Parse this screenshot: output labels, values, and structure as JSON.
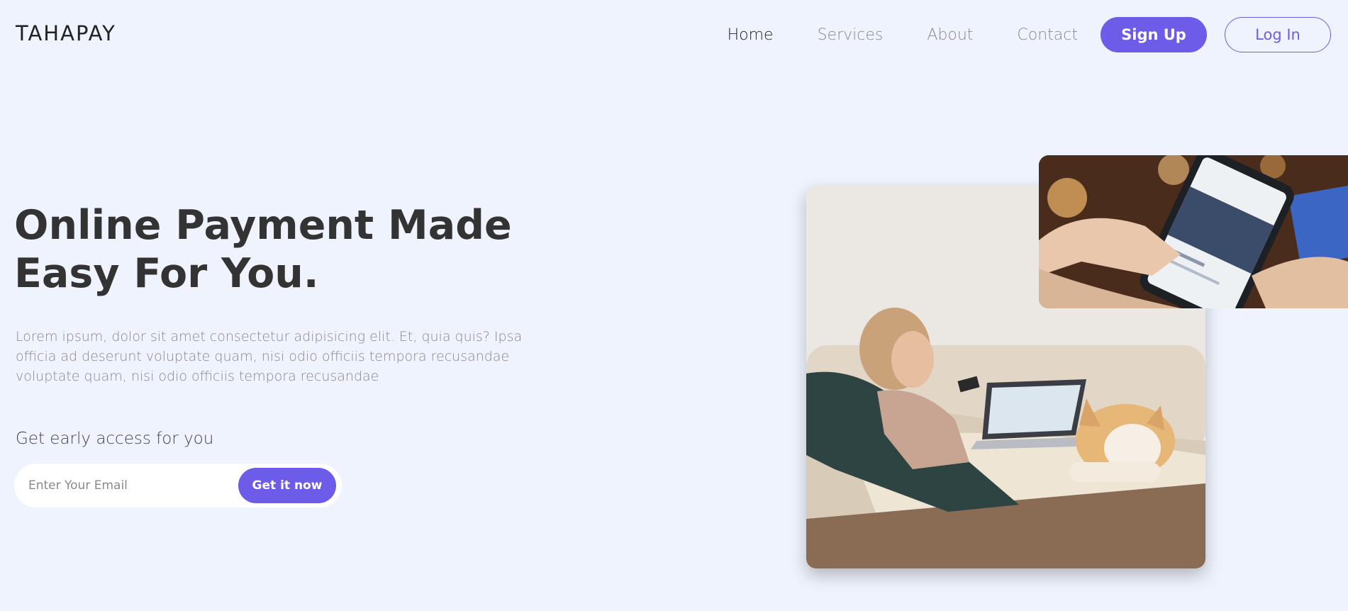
{
  "brand": {
    "logo": "TAHAPAY"
  },
  "nav": {
    "links": [
      "Home",
      "Services",
      "About",
      "Contact"
    ],
    "signup": "Sign Up",
    "login": "Log In"
  },
  "hero": {
    "title_line1": "Online Payment Made",
    "title_line2": "Easy For You.",
    "description": "Lorem ipsum, dolor sit amet consectetur adipisicing elit. Et, quia quis? Ipsa officia ad deserunt voluptate quam, nisi odio officiis tempora recusandae voluptate quam, nisi odio officiis tempora recusandae",
    "early_access": "Get early access for you",
    "email_placeholder": "Enter Your Email",
    "cta": "Get it now"
  },
  "colors": {
    "accent": "#6c5ce7",
    "background": "#eff3fd"
  }
}
